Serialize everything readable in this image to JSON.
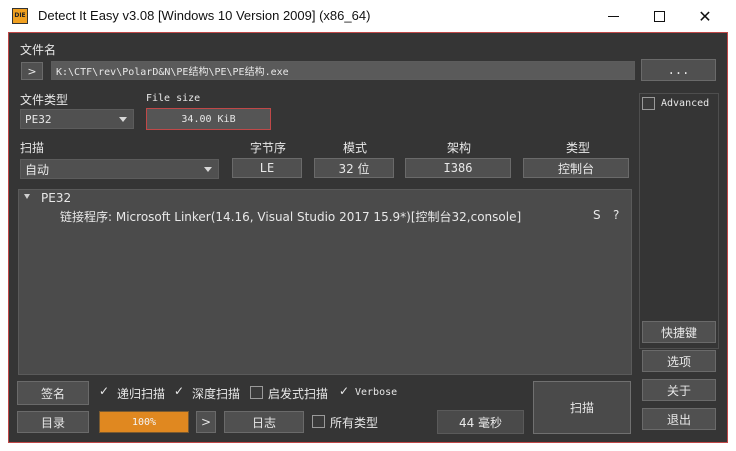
{
  "window": {
    "title": "Detect It Easy v3.08 [Windows 10 Version 2009] (x86_64)",
    "icon_label": "DIE",
    "controls": [
      "minimize-icon",
      "maximize-icon",
      "close-icon"
    ]
  },
  "file": {
    "label": "文件名",
    "expand_symbol": ">",
    "path": "K:\\CTF\\rev\\PolarD&N\\PE结构\\PE\\PE结构.exe",
    "browse_label": "..."
  },
  "file_type": {
    "label": "文件类型",
    "selected": "PE32"
  },
  "file_size": {
    "label": "File size",
    "value": "34.00 KiB"
  },
  "scan": {
    "label": "扫描",
    "mode": "自动"
  },
  "props": {
    "endianness": {
      "label": "字节序",
      "value": "LE"
    },
    "mode": {
      "label": "模式",
      "value": "32 位"
    },
    "arch": {
      "label": "架构",
      "value": "I386"
    },
    "type": {
      "label": "类型",
      "value": "控制台"
    }
  },
  "results": {
    "root": "PE32",
    "entries": [
      {
        "text": "链接程序: Microsoft Linker(14.16, Visual Studio 2017 15.9*)[控制台32,console]",
        "s": "S",
        "q": "?"
      }
    ]
  },
  "advanced": {
    "label": "Advanced",
    "checked": false
  },
  "side_buttons": {
    "shortcuts": "快捷键",
    "options": "选项",
    "about": "关于",
    "exit": "退出"
  },
  "bottom": {
    "signatures": "签名",
    "recursive": {
      "label": "递归扫描",
      "checked": true
    },
    "deep": {
      "label": "深度扫描",
      "checked": true
    },
    "heuristic": {
      "label": "启发式扫描",
      "checked": false
    },
    "verbose": {
      "label": "Verbose",
      "checked": true
    },
    "directory": "目录",
    "progress": "100%",
    "progress_fraction": 1.0,
    "next_symbol": ">",
    "log": "日志",
    "all_types": {
      "label": "所有类型",
      "checked": false
    },
    "elapsed": "44 毫秒",
    "scan_button": "扫描"
  },
  "colors": {
    "background": "#353535",
    "field": "#505050",
    "accent_orange": "#e08820",
    "border_red": "#c04848"
  }
}
